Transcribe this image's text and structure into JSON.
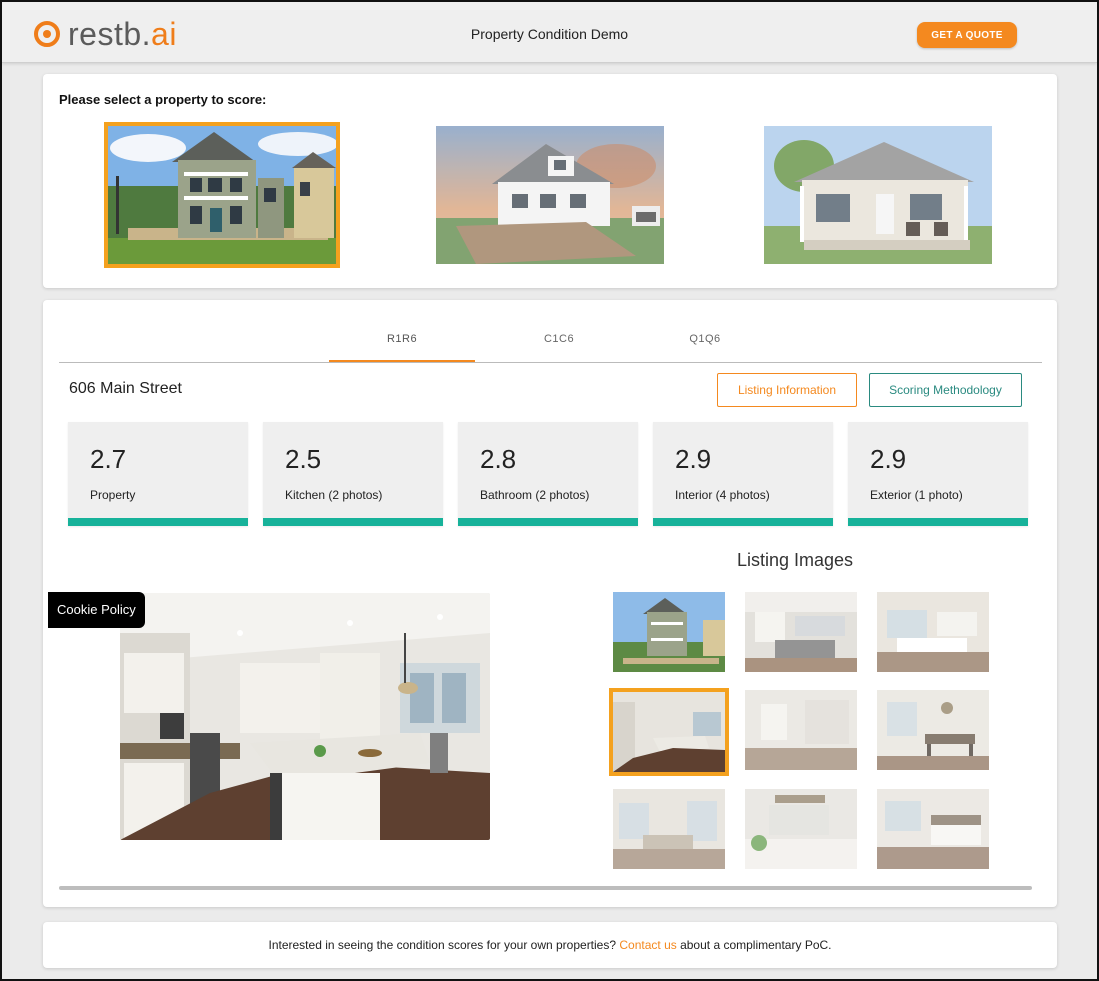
{
  "header": {
    "logo_main": "restb.",
    "logo_accent": "ai",
    "title": "Property Condition Demo",
    "quote_button": "GET A QUOTE"
  },
  "selection": {
    "title": "Please select a property to score:",
    "selected_index": 0
  },
  "tabs": [
    {
      "label": "R1R6",
      "active": true
    },
    {
      "label": "C1C6",
      "active": false
    },
    {
      "label": "Q1Q6",
      "active": false
    }
  ],
  "property": {
    "address": "606 Main Street",
    "listing_button": "Listing Information",
    "methodology_button": "Scoring Methodology"
  },
  "scores": [
    {
      "value": "2.7",
      "label": "Property"
    },
    {
      "value": "2.5",
      "label": "Kitchen (2 photos)"
    },
    {
      "value": "2.8",
      "label": "Bathroom (2 photos)"
    },
    {
      "value": "2.9",
      "label": "Interior (4 photos)"
    },
    {
      "value": "2.9",
      "label": "Exterior (1 photo)"
    }
  ],
  "listing": {
    "title": "Listing Images",
    "selected_thumb": 3
  },
  "cookie": {
    "label": "Cookie Policy"
  },
  "footer": {
    "before": "Interested in seeing the condition scores for your own properties? ",
    "link": "Contact us",
    "after": " about a complimentary PoC."
  },
  "colors": {
    "accent": "#f4891f",
    "selection_border": "#f4a11e",
    "score_bar": "#17b29a",
    "methodology_border": "#2a8a80"
  }
}
